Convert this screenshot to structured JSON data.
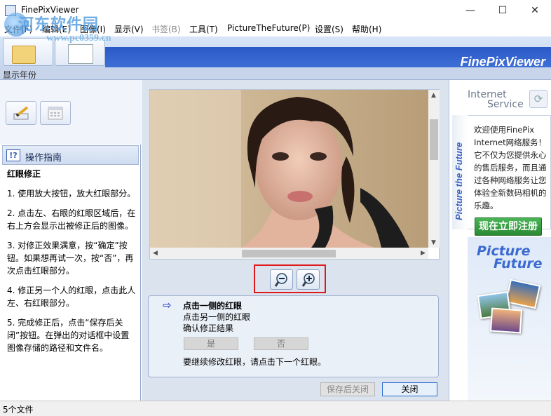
{
  "window": {
    "title": "FinePixViewer",
    "minimize": "—",
    "maximize": "☐",
    "close": "✕"
  },
  "watermark": {
    "line1": "河东软件园",
    "line2": "www.pc0359.cn"
  },
  "menu": {
    "items": [
      "文件(F)",
      "编辑(E)",
      "图像(I)",
      "显示(V)",
      "书签(B)",
      "工具(T)",
      "PictureTheFuture(P)",
      "设置(S)",
      "帮助(H)"
    ]
  },
  "brand": "FinePixViewer",
  "yearbar": {
    "label": "显示年份"
  },
  "guide": {
    "title": "操作指南",
    "heading": "红眼修正",
    "steps": [
      "1. 使用放大按钮，放大红眼部分。",
      "2. 点击左、右眼的红眼区域后，在右上方会显示出被修正后的图像。",
      "3. 对修正效果满意，按“确定”按钮。如果想再试一次，按“否”，再次点击红眼部分。",
      "4. 修正另一个人的红眼，点击此人左、右红眼部分。",
      "5. 完成修正后，点击“保存后关闭”按钮。在弹出的对话框中设置图像存储的路径和文件名。"
    ]
  },
  "redeye": {
    "title": "点击一侧的红眼",
    "line1": "点击另一侧的红眼",
    "line2": "确认修正结果",
    "yes": "是",
    "no": "否",
    "continue": "要继续修改红眼，请点击下一个红眼。"
  },
  "buttons": {
    "save_close": "保存后关闭",
    "close": "关闭"
  },
  "right": {
    "service1": "Internet",
    "service2": "Service",
    "vertical": "Picture the Future",
    "welcome": "欢迎使用FinePix Internet网络服务！它不仅为您提供永心的售后服务，而且通过各种网络服务让您体验全新数码相机的乐趣。",
    "register": "现在立即注册",
    "logo1": "Picture",
    "logo2": "Future"
  },
  "status": {
    "text": "5个文件"
  },
  "icons": {
    "zoom_out": "zoom-out-icon",
    "zoom_in": "zoom-in-icon",
    "refresh": "refresh-icon",
    "arrow": "arrow-right-icon"
  }
}
